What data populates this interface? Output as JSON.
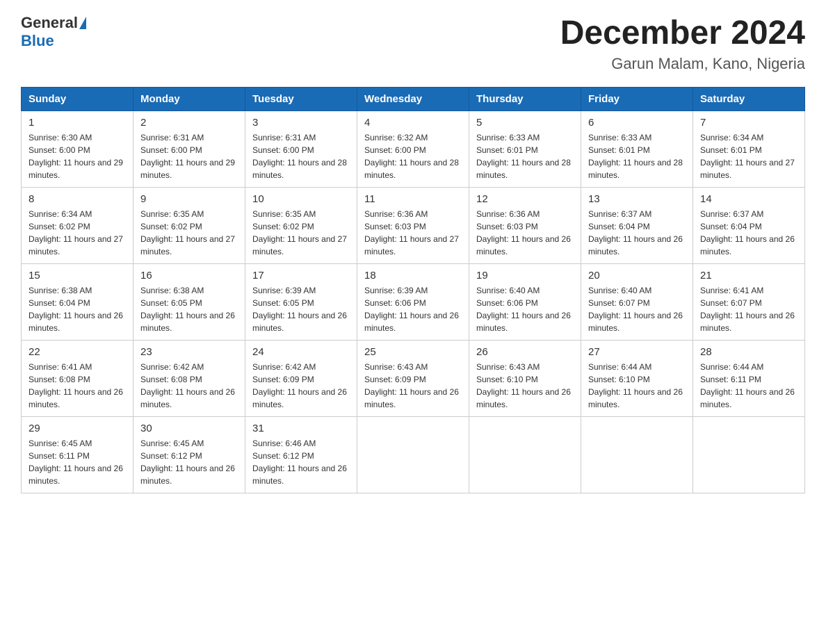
{
  "header": {
    "logo": {
      "general": "General",
      "blue": "Blue"
    },
    "title": "December 2024",
    "subtitle": "Garun Malam, Kano, Nigeria"
  },
  "calendar": {
    "days_of_week": [
      "Sunday",
      "Monday",
      "Tuesday",
      "Wednesday",
      "Thursday",
      "Friday",
      "Saturday"
    ],
    "weeks": [
      [
        {
          "day": "1",
          "sunrise": "6:30 AM",
          "sunset": "6:00 PM",
          "daylight": "11 hours and 29 minutes."
        },
        {
          "day": "2",
          "sunrise": "6:31 AM",
          "sunset": "6:00 PM",
          "daylight": "11 hours and 29 minutes."
        },
        {
          "day": "3",
          "sunrise": "6:31 AM",
          "sunset": "6:00 PM",
          "daylight": "11 hours and 28 minutes."
        },
        {
          "day": "4",
          "sunrise": "6:32 AM",
          "sunset": "6:00 PM",
          "daylight": "11 hours and 28 minutes."
        },
        {
          "day": "5",
          "sunrise": "6:33 AM",
          "sunset": "6:01 PM",
          "daylight": "11 hours and 28 minutes."
        },
        {
          "day": "6",
          "sunrise": "6:33 AM",
          "sunset": "6:01 PM",
          "daylight": "11 hours and 28 minutes."
        },
        {
          "day": "7",
          "sunrise": "6:34 AM",
          "sunset": "6:01 PM",
          "daylight": "11 hours and 27 minutes."
        }
      ],
      [
        {
          "day": "8",
          "sunrise": "6:34 AM",
          "sunset": "6:02 PM",
          "daylight": "11 hours and 27 minutes."
        },
        {
          "day": "9",
          "sunrise": "6:35 AM",
          "sunset": "6:02 PM",
          "daylight": "11 hours and 27 minutes."
        },
        {
          "day": "10",
          "sunrise": "6:35 AM",
          "sunset": "6:02 PM",
          "daylight": "11 hours and 27 minutes."
        },
        {
          "day": "11",
          "sunrise": "6:36 AM",
          "sunset": "6:03 PM",
          "daylight": "11 hours and 27 minutes."
        },
        {
          "day": "12",
          "sunrise": "6:36 AM",
          "sunset": "6:03 PM",
          "daylight": "11 hours and 26 minutes."
        },
        {
          "day": "13",
          "sunrise": "6:37 AM",
          "sunset": "6:04 PM",
          "daylight": "11 hours and 26 minutes."
        },
        {
          "day": "14",
          "sunrise": "6:37 AM",
          "sunset": "6:04 PM",
          "daylight": "11 hours and 26 minutes."
        }
      ],
      [
        {
          "day": "15",
          "sunrise": "6:38 AM",
          "sunset": "6:04 PM",
          "daylight": "11 hours and 26 minutes."
        },
        {
          "day": "16",
          "sunrise": "6:38 AM",
          "sunset": "6:05 PM",
          "daylight": "11 hours and 26 minutes."
        },
        {
          "day": "17",
          "sunrise": "6:39 AM",
          "sunset": "6:05 PM",
          "daylight": "11 hours and 26 minutes."
        },
        {
          "day": "18",
          "sunrise": "6:39 AM",
          "sunset": "6:06 PM",
          "daylight": "11 hours and 26 minutes."
        },
        {
          "day": "19",
          "sunrise": "6:40 AM",
          "sunset": "6:06 PM",
          "daylight": "11 hours and 26 minutes."
        },
        {
          "day": "20",
          "sunrise": "6:40 AM",
          "sunset": "6:07 PM",
          "daylight": "11 hours and 26 minutes."
        },
        {
          "day": "21",
          "sunrise": "6:41 AM",
          "sunset": "6:07 PM",
          "daylight": "11 hours and 26 minutes."
        }
      ],
      [
        {
          "day": "22",
          "sunrise": "6:41 AM",
          "sunset": "6:08 PM",
          "daylight": "11 hours and 26 minutes."
        },
        {
          "day": "23",
          "sunrise": "6:42 AM",
          "sunset": "6:08 PM",
          "daylight": "11 hours and 26 minutes."
        },
        {
          "day": "24",
          "sunrise": "6:42 AM",
          "sunset": "6:09 PM",
          "daylight": "11 hours and 26 minutes."
        },
        {
          "day": "25",
          "sunrise": "6:43 AM",
          "sunset": "6:09 PM",
          "daylight": "11 hours and 26 minutes."
        },
        {
          "day": "26",
          "sunrise": "6:43 AM",
          "sunset": "6:10 PM",
          "daylight": "11 hours and 26 minutes."
        },
        {
          "day": "27",
          "sunrise": "6:44 AM",
          "sunset": "6:10 PM",
          "daylight": "11 hours and 26 minutes."
        },
        {
          "day": "28",
          "sunrise": "6:44 AM",
          "sunset": "6:11 PM",
          "daylight": "11 hours and 26 minutes."
        }
      ],
      [
        {
          "day": "29",
          "sunrise": "6:45 AM",
          "sunset": "6:11 PM",
          "daylight": "11 hours and 26 minutes."
        },
        {
          "day": "30",
          "sunrise": "6:45 AM",
          "sunset": "6:12 PM",
          "daylight": "11 hours and 26 minutes."
        },
        {
          "day": "31",
          "sunrise": "6:46 AM",
          "sunset": "6:12 PM",
          "daylight": "11 hours and 26 minutes."
        },
        null,
        null,
        null,
        null
      ]
    ]
  }
}
